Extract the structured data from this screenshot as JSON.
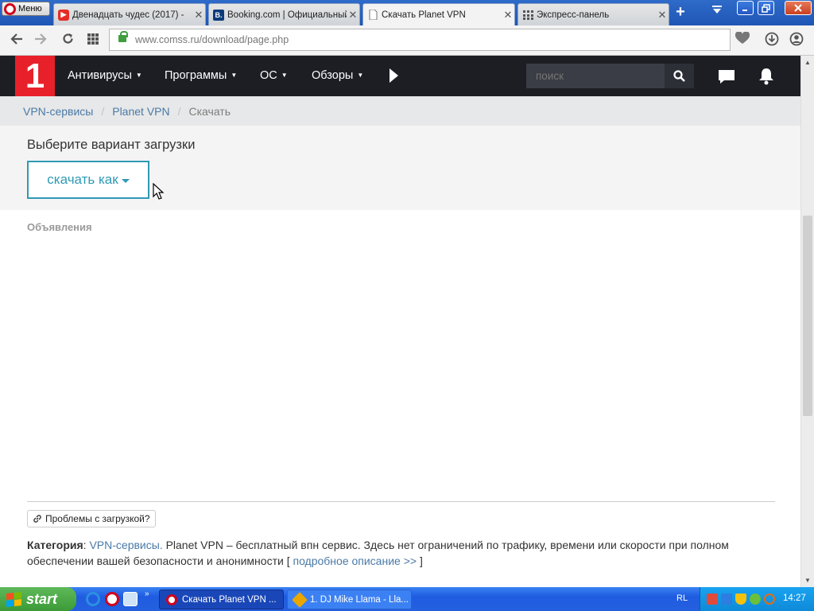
{
  "browser": {
    "menu_label": "Меню",
    "tabs": [
      {
        "title": "Двенадцать чудес (2017) - ",
        "favicon": "youtube-icon",
        "active": false
      },
      {
        "title": "Booking.com | Официальный",
        "favicon": "booking-icon",
        "active": false
      },
      {
        "title": "Скачать Planet VPN",
        "favicon": "page-icon",
        "active": true
      },
      {
        "title": "Экспресс-панель",
        "favicon": "grid-icon",
        "active": false
      }
    ],
    "new_tab": "+",
    "url": "www.comss.ru/download/page.php"
  },
  "site": {
    "logo": "1",
    "nav": [
      {
        "label": "Антивирусы"
      },
      {
        "label": "Программы"
      },
      {
        "label": "ОС"
      },
      {
        "label": "Обзоры"
      }
    ],
    "search_placeholder": "поиск",
    "breadcrumb": {
      "item1": "VPN-сервисы",
      "item2": "Planet VPN",
      "current": "Скачать"
    },
    "choose_title": "Выберите вариант загрузки",
    "download_button": "скачать как",
    "ads_label": "Объявления",
    "problems_button": "Проблемы с загрузкой?",
    "category_label": "Категория",
    "category_link": "VPN-сервисы.",
    "description": " Planet VPN – бесплатный впн сервис. Здесь нет ограничений по трафику, времени или скорости при полном обеспечении вашей безопасности и анонимности ",
    "more_link": "подробное описание >>",
    "bracket_open": "[ ",
    "bracket_close": " ]"
  },
  "taskbar": {
    "start_label": "start",
    "tasks": [
      {
        "label": "Скачать Planet VPN ...",
        "icon": "opera-icon"
      },
      {
        "label": "1. DJ Mike Llama - Lla...",
        "icon": "winamp-icon"
      }
    ],
    "language": "RL",
    "clock": "14:27"
  },
  "colors": {
    "site_nav_bg": "#1c1e24",
    "logo_red": "#e8202a",
    "accent": "#2f9ab5",
    "link": "#4a79a6"
  }
}
